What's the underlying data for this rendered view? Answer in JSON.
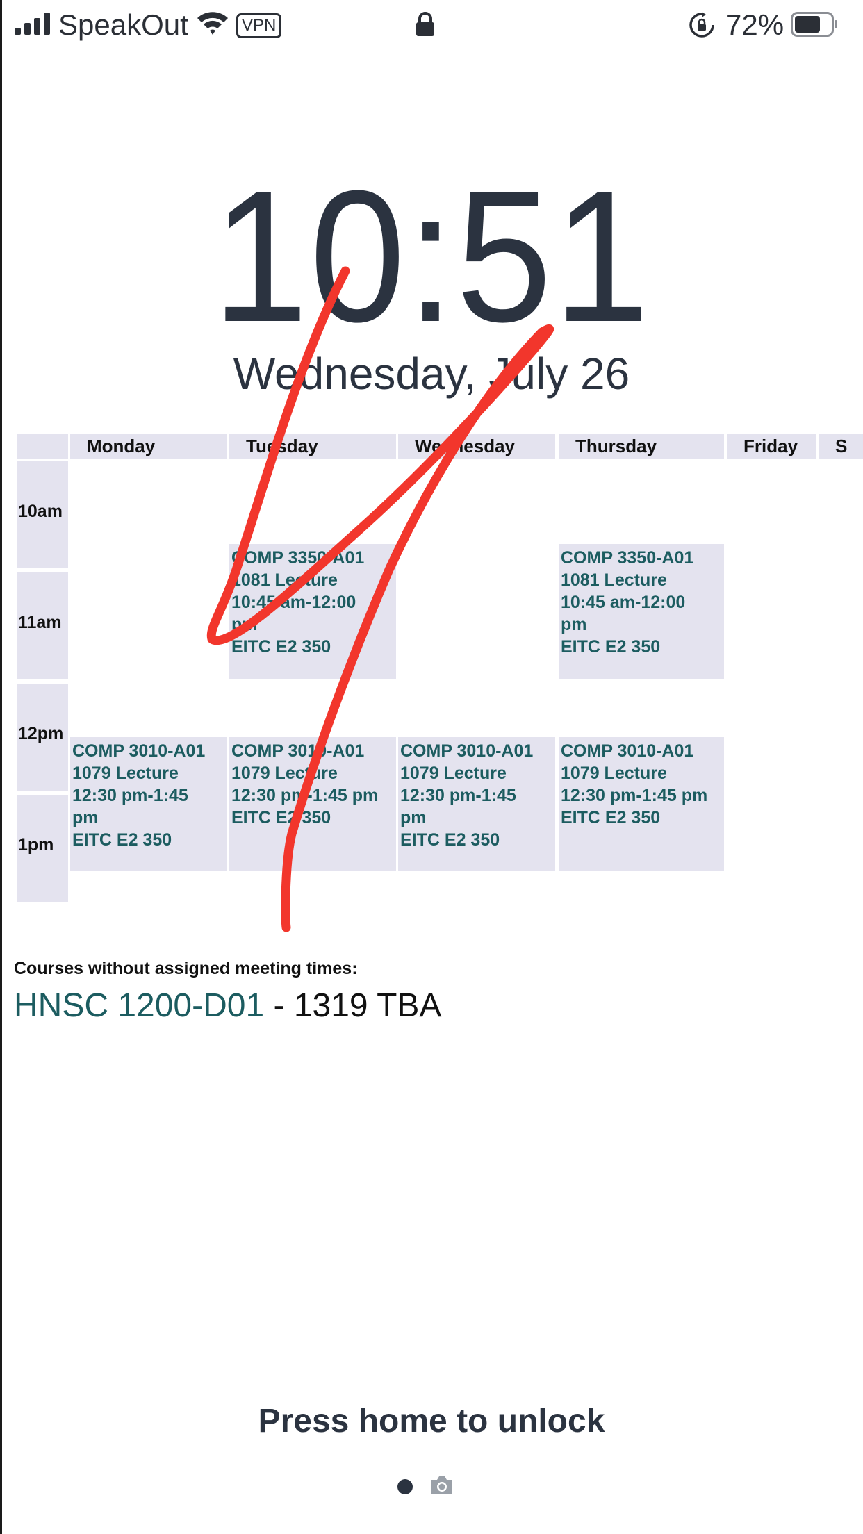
{
  "status_bar": {
    "carrier": "SpeakOut",
    "vpn_label": "VPN",
    "battery_percent": "72%",
    "battery_level": 0.72,
    "icons": [
      "signal-icon",
      "wifi-icon",
      "lock-icon",
      "rotation-lock-icon",
      "battery-icon"
    ]
  },
  "lock_screen": {
    "time": "10:51",
    "date": "Wednesday, July 26",
    "unlock_hint": "Press home to unlock"
  },
  "schedule": {
    "days": [
      "Monday",
      "Tuesday",
      "Wednesday",
      "Thursday",
      "Friday",
      "S"
    ],
    "times": [
      "10am",
      "11am",
      "12pm",
      "1pm"
    ],
    "events": {
      "tue_comp3350": [
        "COMP 3350-A01",
        "1081 Lecture",
        "10:45 am-12:00",
        "pm",
        "EITC E2 350"
      ],
      "thu_comp3350": [
        "COMP 3350-A01",
        "1081 Lecture",
        "10:45 am-12:00",
        "pm",
        "EITC E2 350"
      ],
      "mon_comp3010": [
        "COMP 3010-A01",
        "1079 Lecture",
        "12:30 pm-1:45",
        "pm",
        "EITC E2 350"
      ],
      "tue_comp3010": [
        "COMP 3010-A01",
        "1079 Lecture",
        "12:30 pm-1:45 pm",
        "EITC E2 350"
      ],
      "wed_comp3010": [
        "COMP 3010-A01",
        "1079 Lecture",
        "12:30 pm-1:45",
        "pm",
        "EITC E2 350"
      ],
      "thu_comp3010": [
        "COMP 3010-A01",
        "1079 Lecture",
        "12:30 pm-1:45 pm",
        "EITC E2 350"
      ]
    },
    "unassigned_label": "Courses without assigned meeting times:",
    "unassigned_course": "HNSC 1200-D01",
    "unassigned_detail": " - 1319 TBA"
  },
  "colors": {
    "text_dark": "#2b3340",
    "cell_bg": "#e4e3ef",
    "course_teal": "#1c5c60",
    "annotation_red": "#f2362c"
  }
}
